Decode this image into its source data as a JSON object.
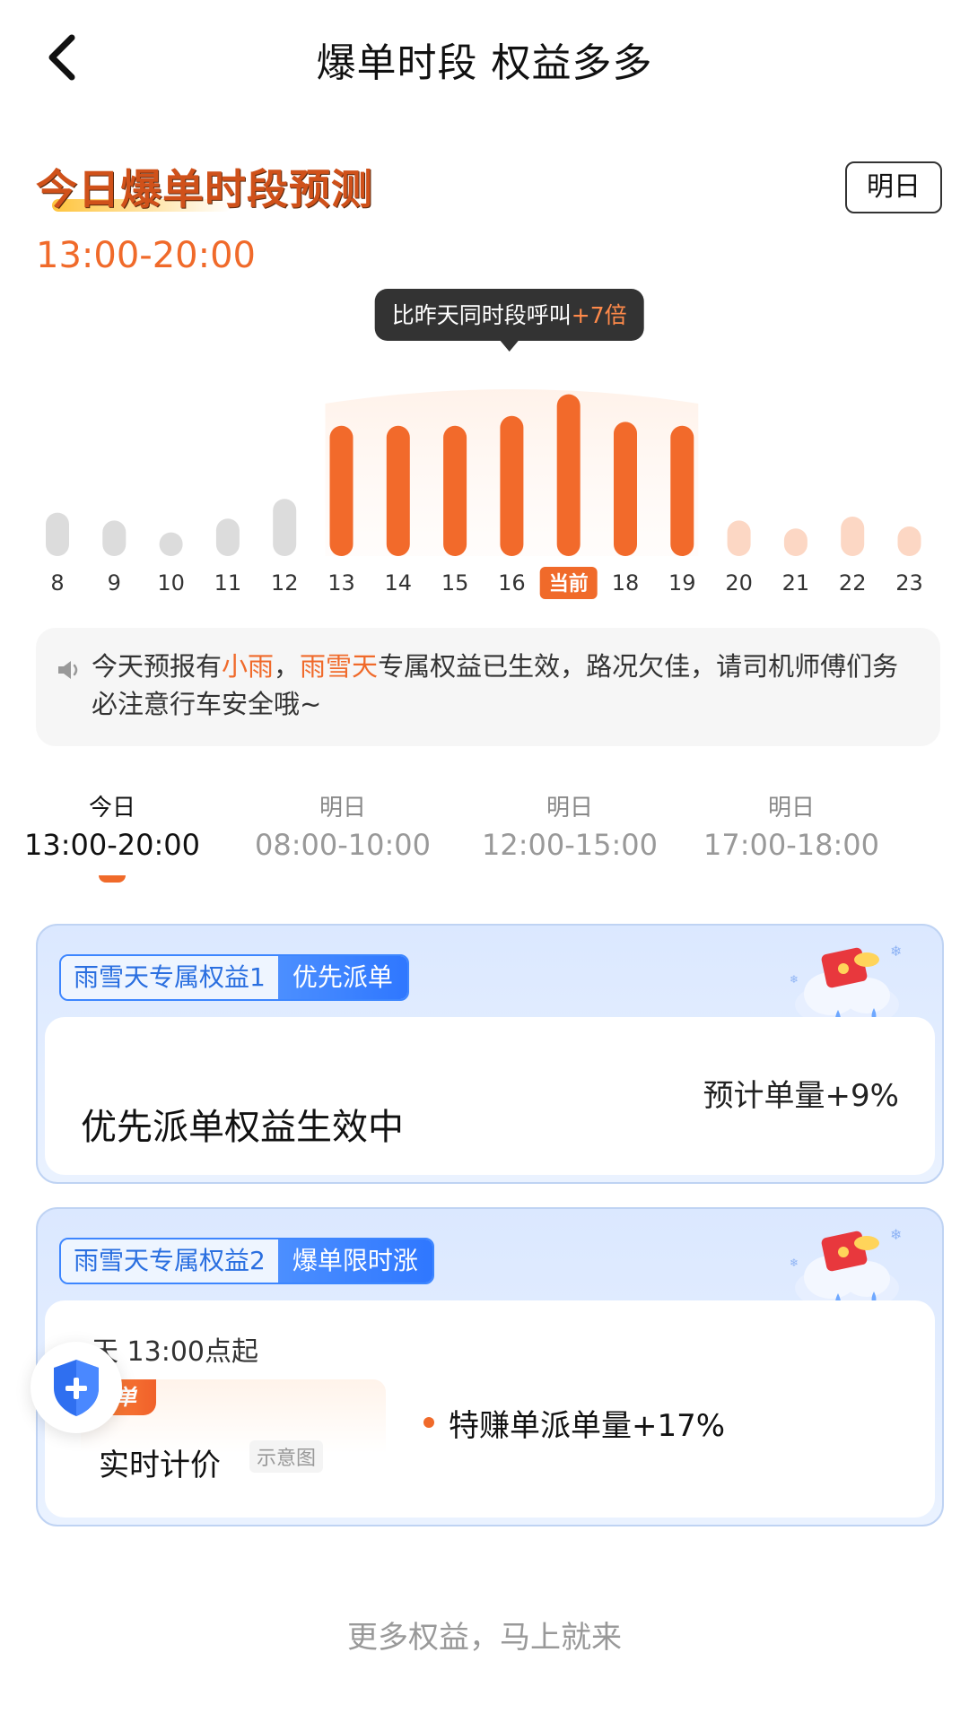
{
  "header": {
    "title": "爆单时段 权益多多",
    "back_icon": "chevron-left-icon"
  },
  "forecast": {
    "title": "今日爆单时段预测",
    "tomorrow_button": "明日",
    "peak_time": "13:00-20:00"
  },
  "chart_data": {
    "type": "bar",
    "categories": [
      "8",
      "9",
      "10",
      "11",
      "12",
      "13",
      "14",
      "15",
      "16",
      "当前",
      "18",
      "19",
      "20",
      "21",
      "22",
      "23"
    ],
    "values": [
      22,
      18,
      12,
      19,
      29,
      66,
      66,
      66,
      71,
      82,
      68,
      66,
      18,
      14,
      20,
      15
    ],
    "highlight_range": [
      "13",
      "19"
    ],
    "current_label": "当前",
    "tooltip": {
      "text": "比昨天同时段呼叫",
      "value": "+7倍"
    },
    "colors": {
      "past": "#dcdcdc",
      "peak": "#f26a2b",
      "future": "#fcd7c4",
      "current_badge": "#f06a2a"
    }
  },
  "notice": {
    "icon": "speaker-icon",
    "prefix": "今天预报有",
    "weather": "小雨",
    "sep": "，",
    "highlight": "雨雪天",
    "suffix": "专属权益已生效，路况欠佳，请司机师傅们务必注意行车安全哦~"
  },
  "tabs": [
    {
      "day": "今日",
      "range": "13:00-20:00",
      "active": true
    },
    {
      "day": "明日",
      "range": "08:00-10:00",
      "active": false
    },
    {
      "day": "明日",
      "range": "12:00-15:00",
      "active": false
    },
    {
      "day": "明日",
      "range": "17:00-18:00",
      "active": false
    }
  ],
  "cards": {
    "c1": {
      "tag_label": "雨雪天专属权益1",
      "tag_value": "优先派单",
      "main": "优先派单权益生效中",
      "estimate": "预计单量+9%"
    },
    "c2": {
      "tag_label": "雨雪天专属权益2",
      "tag_value": "爆单限时涨",
      "start": "天 13:00点起",
      "badge": "赚单",
      "pricing_title": "实时计价",
      "pricing_note": "示意图",
      "metric": "特赚单派单量+17%"
    }
  },
  "floating": {
    "icon": "shield-plus-icon"
  },
  "footer": {
    "text": "更多权益，马上就来"
  }
}
